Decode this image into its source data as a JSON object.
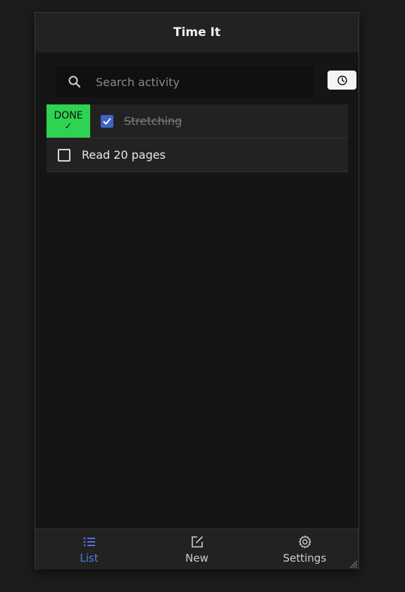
{
  "app": {
    "title": "Time It"
  },
  "search": {
    "placeholder": "Search activity"
  },
  "icons": {
    "search": "search-icon",
    "history": "clock-icon"
  },
  "activities": [
    {
      "name": "Stretching",
      "done": true,
      "badge": "DONE",
      "badge_mark": "✓"
    },
    {
      "name": "Read 20 pages",
      "done": false
    }
  ],
  "nav": {
    "items": [
      {
        "label": "List",
        "icon": "list-icon",
        "active": true
      },
      {
        "label": "New",
        "icon": "edit-icon",
        "active": false
      },
      {
        "label": "Settings",
        "icon": "gear-icon",
        "active": false
      }
    ]
  },
  "colors": {
    "accent": "#4f7ef0",
    "done_badge": "#2fd352",
    "checkbox_checked": "#3f63c4",
    "background": "#151515",
    "surface": "#222222"
  }
}
